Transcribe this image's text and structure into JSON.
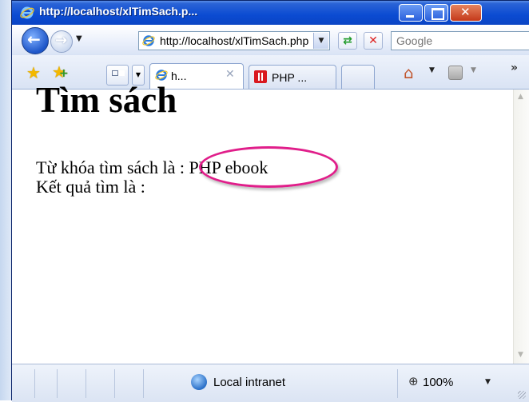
{
  "window": {
    "title": "http://localhost/xlTimSach.p..."
  },
  "navbar": {
    "address": "http://localhost/xlTimSach.php",
    "search_placeholder": "Google"
  },
  "tabs": [
    {
      "label": "h...",
      "active": true,
      "icon": "ie-icon"
    },
    {
      "label": "PHP ...",
      "active": false,
      "icon": "php-icon"
    }
  ],
  "page": {
    "heading": "Tìm sách",
    "keyword_line": "Từ khóa tìm sách là : PHP ebook",
    "result_line": "Kết quả tìm là :"
  },
  "statusbar": {
    "zone": "Local intranet",
    "zoom": "100%"
  },
  "colors": {
    "titlebar": "#0b4bd2",
    "highlight": "#e01e8a"
  }
}
